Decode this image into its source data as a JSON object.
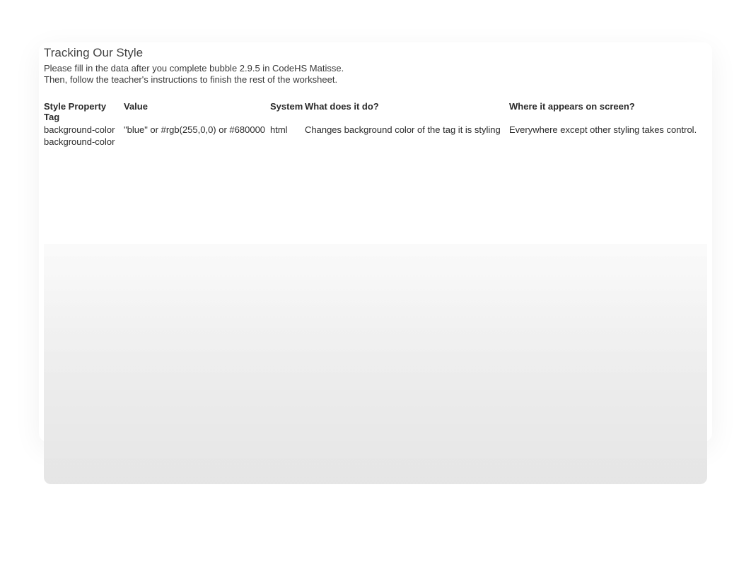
{
  "header": {
    "title": "Tracking Our Style",
    "instructions_line1": "Please fill in the data after you complete bubble 2.9.5 in CodeHS Matisse.",
    "instructions_line2": "Then, follow the teacher's instructions to finish the rest of the worksheet."
  },
  "table": {
    "columns": {
      "c1": "Style Property Tag",
      "c2": "Value",
      "c3": "System",
      "c4": "What does it do?",
      "c5": "Where it appears on screen?"
    },
    "rows": [
      {
        "style_property_tag": "background-color",
        "value": "\"blue\" or #rgb(255,0,0) or #680000",
        "system": "html",
        "what_does_it_do": "Changes background color of the tag it is styling",
        "where_appears": "Everywhere except other styling takes control."
      },
      {
        "style_property_tag": "background-color",
        "value": "",
        "system": "",
        "what_does_it_do": "",
        "where_appears": ""
      }
    ]
  }
}
